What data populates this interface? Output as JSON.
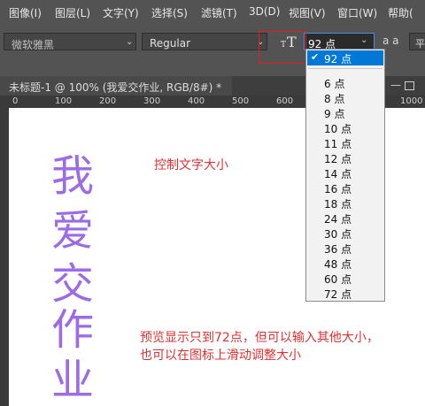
{
  "menubar": {
    "items": [
      "图像(I)",
      "图层(L)",
      "文字(Y)",
      "选择(S)",
      "滤镜(T)",
      "3D(D)",
      "视图(V)",
      "窗口(W)",
      "帮助("
    ]
  },
  "options": {
    "font_family": "微软雅黑",
    "font_style": "Regular",
    "size_value": "92 点",
    "aa_label": "a a",
    "align_partial": "平"
  },
  "size_dropdown": {
    "selected": "92 点",
    "check": "✔",
    "options": [
      "6 点",
      "8 点",
      "9 点",
      "10 点",
      "11 点",
      "12 点",
      "14 点",
      "16 点",
      "18 点",
      "24 点",
      "30 点",
      "36 点",
      "48 点",
      "60 点",
      "72 点"
    ]
  },
  "document": {
    "tab_title": "未标题-1 @ 100% (我爱交作业, RGB/8#) *",
    "ruler_labels": [
      "0",
      "100",
      "200",
      "300",
      "400",
      "500",
      "600",
      "1000"
    ],
    "vertical_text": [
      "我",
      "爱",
      "交",
      "作",
      "业"
    ]
  },
  "annotations": {
    "top": "控制文字大小",
    "bottom_line1": "预览显示只到72点，但可以输入其他大小，",
    "bottom_line2": "也可以在图标上滑动调整大小"
  },
  "colors": {
    "text_purple": "#9b6be8",
    "annotation_red": "#e03030",
    "ui_dark": "#535353",
    "select_blue": "#0078d7"
  },
  "icons": [
    "text-size-icon",
    "chevron-down-icon",
    "checkmark-icon",
    "close-icon",
    "minimize-icon",
    "restore-icon"
  ]
}
